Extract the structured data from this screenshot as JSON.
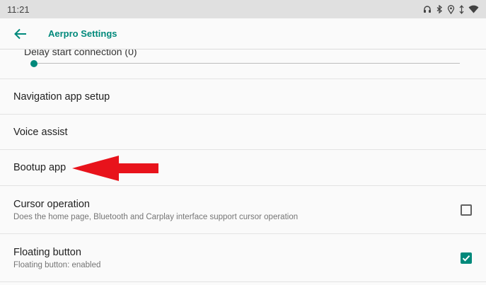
{
  "statusbar": {
    "time": "11:21",
    "icons": [
      "headset-icon",
      "bluetooth-icon",
      "location-icon",
      "data-icon",
      "wifi-icon"
    ]
  },
  "appbar": {
    "title": "Aerpro Settings",
    "back_icon": "arrow-left-icon"
  },
  "slider": {
    "label": "Delay start connection (0)",
    "value": 0
  },
  "prefs": [
    {
      "title": "Navigation app setup"
    },
    {
      "title": "Voice assist"
    },
    {
      "title": "Bootup app"
    },
    {
      "title": "Cursor operation",
      "summary": "Does the home page, Bluetooth and Carplay interface support cursor operation",
      "checked": false
    },
    {
      "title": "Floating button",
      "summary": "Floating button: enabled",
      "checked": true
    }
  ],
  "colors": {
    "accent": "#00897b",
    "annotation_arrow": "#e8131b",
    "statusbar": "#e0e0e0"
  }
}
